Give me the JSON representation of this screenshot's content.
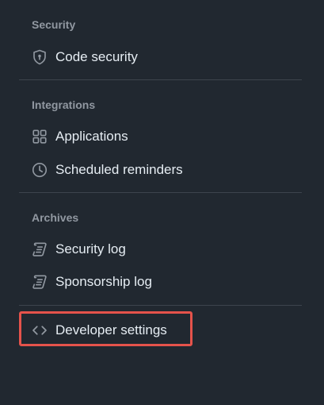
{
  "sections": [
    {
      "heading": "Security",
      "items": [
        {
          "label": "Code security",
          "icon": "shield-lock-icon"
        }
      ]
    },
    {
      "heading": "Integrations",
      "items": [
        {
          "label": "Applications",
          "icon": "apps-grid-icon"
        },
        {
          "label": "Scheduled reminders",
          "icon": "clock-icon"
        }
      ]
    },
    {
      "heading": "Archives",
      "items": [
        {
          "label": "Security log",
          "icon": "log-icon"
        },
        {
          "label": "Sponsorship log",
          "icon": "log-icon"
        }
      ]
    }
  ],
  "footer": {
    "developer_settings_label": "Developer settings",
    "icon": "code-icon"
  },
  "colors": {
    "background": "#212830",
    "heading": "#9198a1",
    "text": "#e6edf3",
    "divider": "#3d444d",
    "highlight": "#e5534b"
  }
}
